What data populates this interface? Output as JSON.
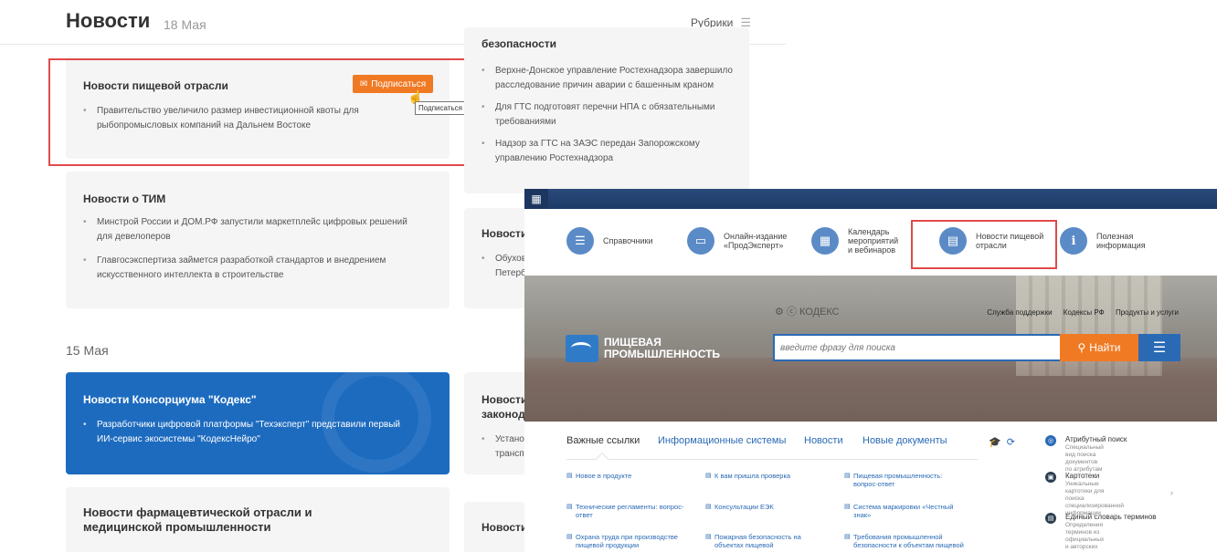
{
  "news": {
    "title": "Новости",
    "date": "18 Мая",
    "rubrics": "Рубрики",
    "section_date_15": "15 Мая"
  },
  "cards": {
    "food": {
      "title": "Новости пищевой отрасли",
      "subscribe": "Подписаться",
      "tooltip": "Подписаться",
      "bullets": [
        "Правительство увеличило размер инвестиционной квоты для\nрыбопромысловых компаний на Дальнем Востоке"
      ]
    },
    "tim": {
      "title": "Новости о ТИМ",
      "bullets": [
        "Минстрой России и ДОМ.РФ запустили маркетплейс цифровых решений\nдля девелоперов",
        "Главгосэкспертиза займется разработкой стандартов и внедрением\nискусственного интеллекта в строительстве"
      ]
    },
    "kodeks": {
      "title": "Новости Консорциума \"Кодекс\"",
      "bullets": [
        "Разработчики цифровой платформы \"Техэксперт\" представили первый\nИИ-сервис экосистемы \"КодексНейро\""
      ]
    },
    "pharma": {
      "title": "Новости фармацевтической отрасли и\nмедицинской промышленности"
    }
  },
  "col2": {
    "safety_title": "безопасности",
    "safety_bullets": [
      "Верхне-Донское управление Ростехнадзора завершило\nрасследование причин аварии с башенным краном",
      "Для ГТС подготовят перечни НПА с обязательными\nтребованиями",
      "Надзор за ГТС на ЗАЭС передан Запорожскому\nуправлению Ростехнадзора"
    ],
    "card2_title": "Новости",
    "card2_bullet": "Обухов\nПетерб",
    "card3_title": "Новости\nзаконод",
    "card3_bullet": "Устано\nтрансп",
    "card4_title": "Новости"
  },
  "overlay": {
    "nav": [
      {
        "label": "Справочники",
        "icon": "list-icon"
      },
      {
        "label": "Онлайн-издание\n«ПродЭксперт»",
        "icon": "monitor-icon"
      },
      {
        "label": "Календарь\nмероприятий\nи вебинаров",
        "icon": "calendar-icon"
      },
      {
        "label": "Новости пищевой\nотрасли",
        "icon": "news-icon"
      },
      {
        "label": "Полезная\nинформация",
        "icon": "info-icon"
      }
    ],
    "kodeks_logo": "КОДЕКС",
    "top_links": [
      "Служба поддержки",
      "Кодексы РФ",
      "Продукты и услуги"
    ],
    "brand": "ПИЩЕВАЯ\nПРОМЫШЛЕННОСТЬ",
    "search_placeholder": "введите фразу для поиска",
    "search_button": "Найти",
    "tabs": [
      "Важные ссылки",
      "Информационные системы",
      "Новости",
      "Новые документы"
    ],
    "links": [
      [
        "Новое в продукте",
        "К вам пришла проверка",
        "Пищевая промышленность:\nвопрос-ответ"
      ],
      [
        "Технические регламенты: вопрос-\nответ",
        "Консультации ЕЭК",
        "Система маркировки «Честный\nзнак»"
      ],
      [
        "Охрана труда при производстве\nпищевой продукции",
        "Пожарная безопасность на\nобъектах пищевой",
        "Требования промышленной\nбезопасности к объектам пищевой"
      ]
    ],
    "side": [
      {
        "title": "Атрибутный поиск",
        "desc": "Специальный вид поиска\nдокументов по атрибутам"
      },
      {
        "title": "Картотеки",
        "desc": "Уникальные картотеки для поиска\nспециализированной информации"
      },
      {
        "title": "Единый словарь терминов",
        "desc": "Определения терминов из\nофициальных и авторских\nисточников"
      }
    ]
  }
}
